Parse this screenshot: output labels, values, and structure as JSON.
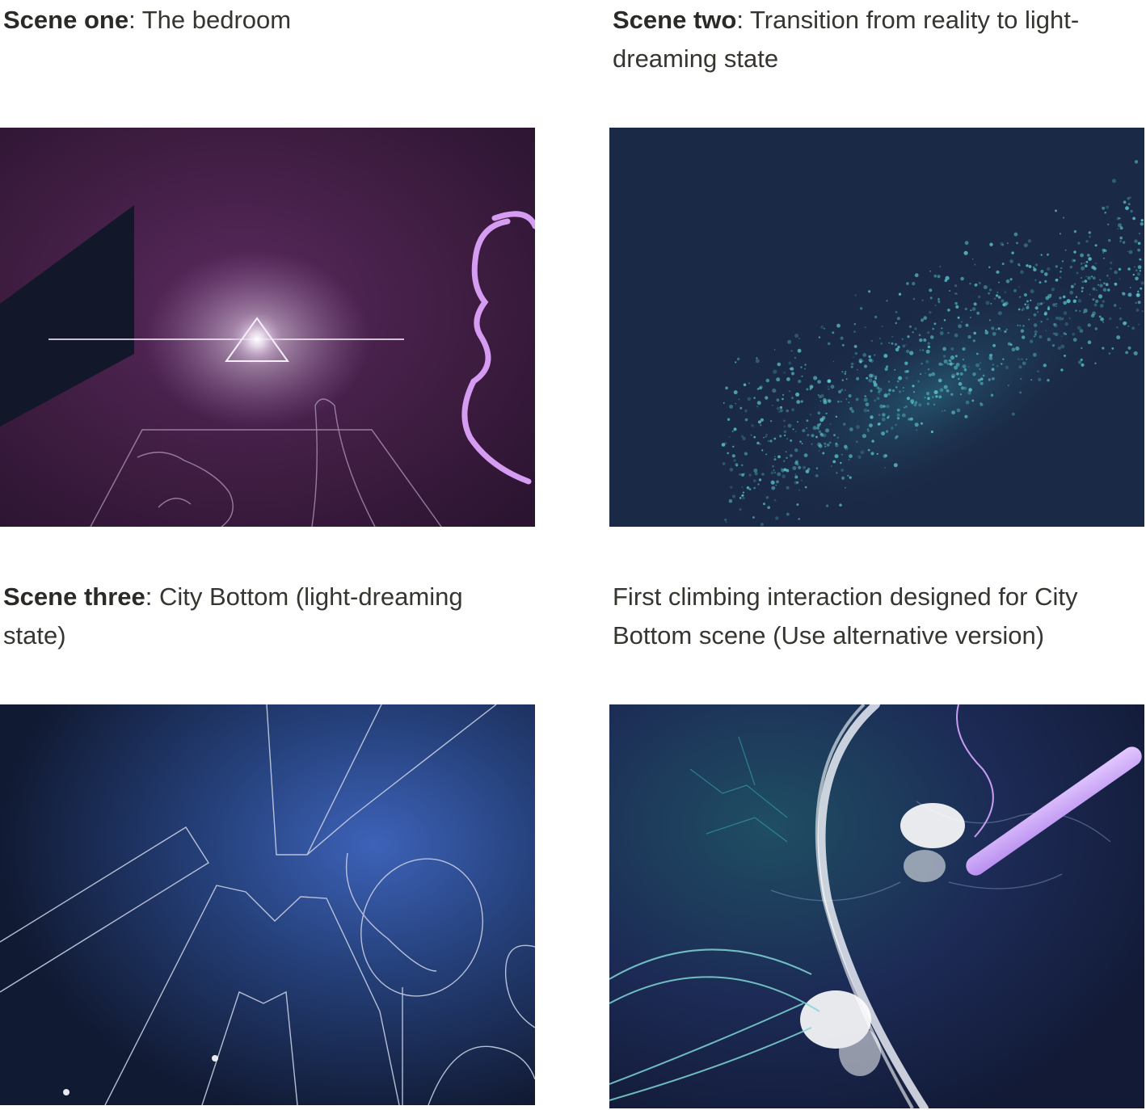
{
  "scenes": [
    {
      "caption_bold": "Scene one",
      "caption_text": ": The bedroom",
      "image_alt": "Bedroom scene illustration"
    },
    {
      "caption_bold": "Scene two",
      "caption_text": ": Transition from reality to light-dreaming state",
      "image_alt": "Transition particles illustration"
    },
    {
      "caption_bold": "Scene three",
      "caption_text": ": City Bottom (light-dreaming state)",
      "image_alt": "City Bottom illustration"
    },
    {
      "caption_bold": "",
      "caption_text": "First climbing interaction designed for City Bottom scene (Use alternative version)",
      "image_alt": "Climbing interaction illustration"
    }
  ],
  "colors": {
    "text": "#37352f",
    "bedroom_bg": "#3a1b3d",
    "transition_bg": "#1a2946",
    "city_bg": "#14203f",
    "climb_bg": "#15203f",
    "accent_purple": "#c98bf0",
    "accent_cyan": "#5fd0d8"
  }
}
